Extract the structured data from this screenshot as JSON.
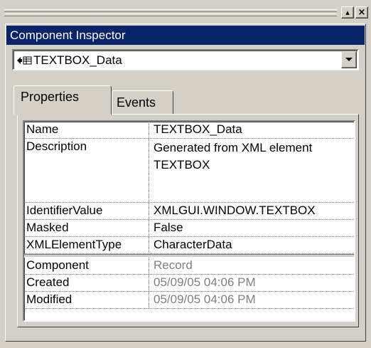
{
  "panel": {
    "title": "Component Inspector"
  },
  "selector": {
    "selected": "TEXTBOX_Data"
  },
  "tabs": [
    {
      "label": "Properties",
      "active": true
    },
    {
      "label": "Events",
      "active": false
    }
  ],
  "properties": [
    {
      "name": "Name",
      "value": "TEXTBOX_Data"
    },
    {
      "name": "Description",
      "value_lines": [
        "Generated from XML element",
        "TEXTBOX"
      ]
    },
    {
      "name": "IdentifierValue",
      "value": "XMLGUI.WINDOW.TEXTBOX"
    },
    {
      "name": "Masked",
      "value": "False"
    },
    {
      "name": "XMLElementType",
      "value": "CharacterData"
    }
  ],
  "readonly_properties": [
    {
      "name": "Component",
      "value": "Record"
    },
    {
      "name": "Created",
      "value": "05/09/05 04:06 PM"
    },
    {
      "name": "Modified",
      "value": "05/09/05 04:06 PM"
    }
  ],
  "colors": {
    "titlebar": "#0a246a",
    "face": "#d4d0c8",
    "readonly_text": "#808080"
  },
  "icons": [
    "restore-icon",
    "close-icon",
    "component-icon",
    "dropdown-arrow-icon"
  ]
}
